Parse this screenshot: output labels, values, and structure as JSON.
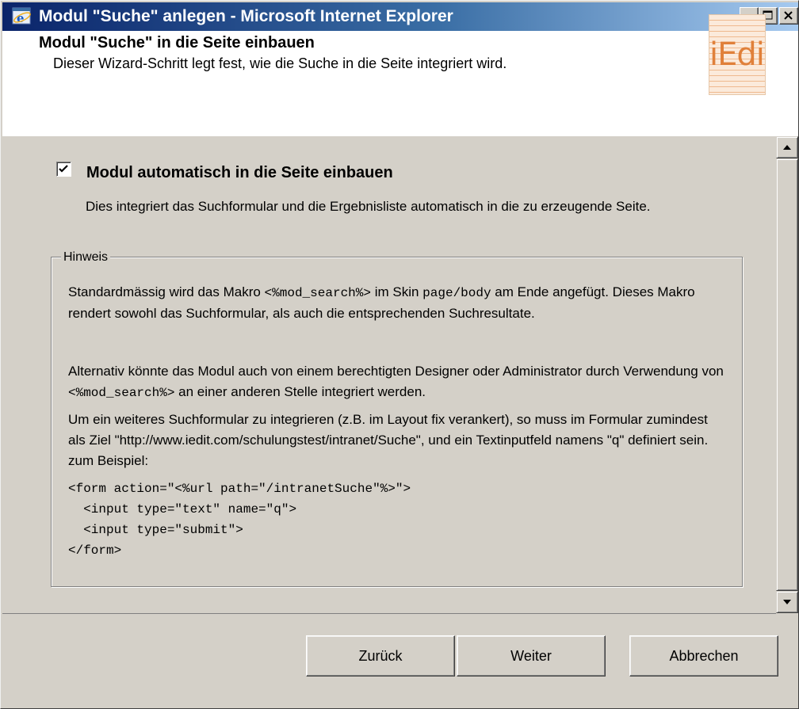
{
  "window": {
    "title": "Modul \"Suche\" anlegen - Microsoft Internet Explorer"
  },
  "header": {
    "title": "Modul \"Suche\" in die Seite einbauen",
    "subtitle": "Dieser Wizard-Schritt legt fest, wie die Suche in die Seite integriert wird.",
    "logo_text": "iEdit"
  },
  "content": {
    "checkbox_checked": true,
    "checkbox_label": "Modul automatisch in die Seite einbauen",
    "checkbox_description": "Dies integriert das Suchformular und die Ergebnisliste automatisch in die zu erzeugende Seite.",
    "hint": {
      "legend": "Hinweis",
      "p1_a": "Standardmässig wird das Makro ",
      "p1_code1": "<%mod_search%>",
      "p1_b": " im Skin ",
      "p1_code2": "page/body",
      "p1_c": " am Ende angefügt. Dieses Makro rendert sowohl das Suchformular, als auch die entsprechenden Suchresultate.",
      "p2_a": "Alternativ könnte das Modul auch von einem berechtigten Designer oder Administrator durch Verwendung von ",
      "p2_code": "<%mod_search%>",
      "p2_b": " an einer anderen Stelle integriert werden.",
      "p3": "Um ein weiteres Suchformular zu integrieren (z.B. im Layout fix verankert), so muss im Formular zumindest als Ziel \"http://www.iedit.com/schulungstest/intranet/Suche\", und ein Textinputfeld namens \"q\" definiert sein. zum Beispiel:",
      "code_lines": [
        "<form action=\"<%url path=\"/intranetSuche\"%>\">",
        "  <input type=\"text\" name=\"q\">",
        "  <input type=\"submit\">",
        "</form>"
      ]
    }
  },
  "buttons": {
    "back": "Zurück",
    "next": "Weiter",
    "cancel": "Abbrechen"
  }
}
